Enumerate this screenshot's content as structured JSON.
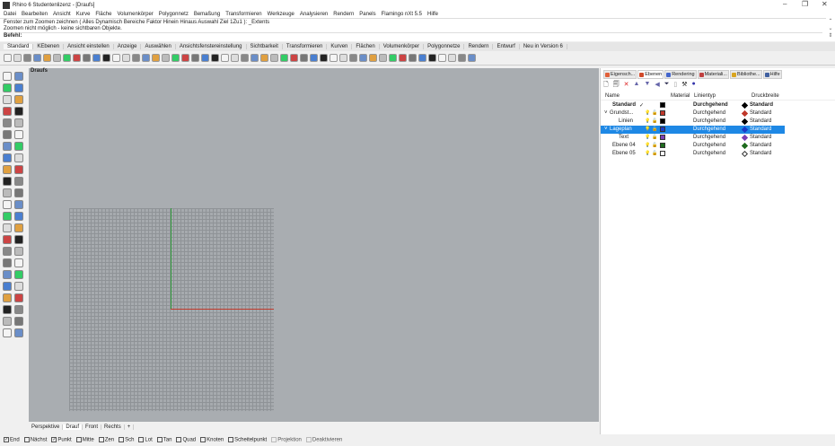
{
  "window": {
    "title": "Rhino 6 Studentenlizenz - [Draufs]",
    "min": "–",
    "max": "❐",
    "close": "✕"
  },
  "menu": [
    "Datei",
    "Bearbeiten",
    "Ansicht",
    "Kurve",
    "Fläche",
    "Volumenkörper",
    "Polygonnetz",
    "Bemaßung",
    "Transformieren",
    "Werkzeuge",
    "Analysieren",
    "Rendern",
    "Panels",
    "Flamingo nXt 5.5",
    "Hilfe"
  ],
  "command": {
    "line1": "Fenster zum Zoomen zeichnen ( Alles Dynamisch Bereiche Faktor Hinein Hinaus Auswahl Ziel 1Zu1 ): _Extents",
    "line2": "Zoomen nicht möglich - keine sichtbaren Objekte.",
    "prompt": "Befehl:"
  },
  "toolbar_tabs": [
    "Standard",
    "KEbenen",
    "Ansicht einstellen",
    "Anzeige",
    "Auswählen",
    "Ansichtsfenstereinstellung",
    "Sichtbarkeit",
    "Transformieren",
    "Kurven",
    "Flächen",
    "Volumenkörper",
    "Polygonnetze",
    "Rendern",
    "Entwurf",
    "Neu in Version 6"
  ],
  "viewport": {
    "label": "Draufs",
    "tabs": [
      "Perspektive",
      "Drauf",
      "Front",
      "Rechts"
    ],
    "add": "+"
  },
  "osnap": [
    {
      "label": "End",
      "checked": true
    },
    {
      "label": "Nächst",
      "checked": false
    },
    {
      "label": "Punkt",
      "checked": true
    },
    {
      "label": "Mitte",
      "checked": false
    },
    {
      "label": "Zen",
      "checked": false
    },
    {
      "label": "Sch",
      "checked": false
    },
    {
      "label": "Lot",
      "checked": false
    },
    {
      "label": "Tan",
      "checked": false
    },
    {
      "label": "Quad",
      "checked": false
    },
    {
      "label": "Knoten",
      "checked": false
    },
    {
      "label": "Scheitelpunkt",
      "checked": false
    },
    {
      "label": "Projektion",
      "checked": false,
      "disabled": true
    },
    {
      "label": "Deaktivieren",
      "checked": false,
      "disabled": true
    }
  ],
  "panel": {
    "tabs": [
      {
        "label": "Eigensch...",
        "color": "#e0603a"
      },
      {
        "label": "Ebenen",
        "color": "#d04a2a"
      },
      {
        "label": "Rendering",
        "color": "#4466cc"
      },
      {
        "label": "Materiali...",
        "color": "#c04040"
      },
      {
        "label": "Bibliothe...",
        "color": "#d9a520"
      },
      {
        "label": "Hilfe",
        "color": "#4060a0"
      }
    ],
    "columns": {
      "name": "Name",
      "material": "Material",
      "linetype": "Linientyp",
      "printwidth": "Druckbreite"
    },
    "layers": [
      {
        "name": "Standard",
        "check": "✓",
        "color": "#000000",
        "linetype": "Durchgehend",
        "printwidth": "Standard",
        "bold": true,
        "indent": 0
      },
      {
        "name": "Grundst...",
        "expand": "˅",
        "color": "#c0392b",
        "linetype": "Durchgehend",
        "printwidth": "Standard",
        "indent": 0
      },
      {
        "name": "Linien",
        "color": "#000000",
        "linetype": "Durchgehend",
        "printwidth": "Standard",
        "indent": 1
      },
      {
        "name": "Lageplan",
        "expand": "˅",
        "color": "#1a3cc8",
        "linetype": "Durchgehend",
        "printwidth": "Standard",
        "indent": 0,
        "selected": true
      },
      {
        "name": "Text",
        "color": "#7b3fb5",
        "linetype": "Durchgehend",
        "printwidth": "Standard",
        "indent": 1
      },
      {
        "name": "Ebene 04",
        "color": "#1e6b1e",
        "linetype": "Durchgehend",
        "printwidth": "Standard",
        "indent": 0
      },
      {
        "name": "Ebene 05",
        "color": "#ffffff",
        "linetype": "Durchgehend",
        "printwidth": "Standard",
        "indent": 0
      }
    ]
  }
}
